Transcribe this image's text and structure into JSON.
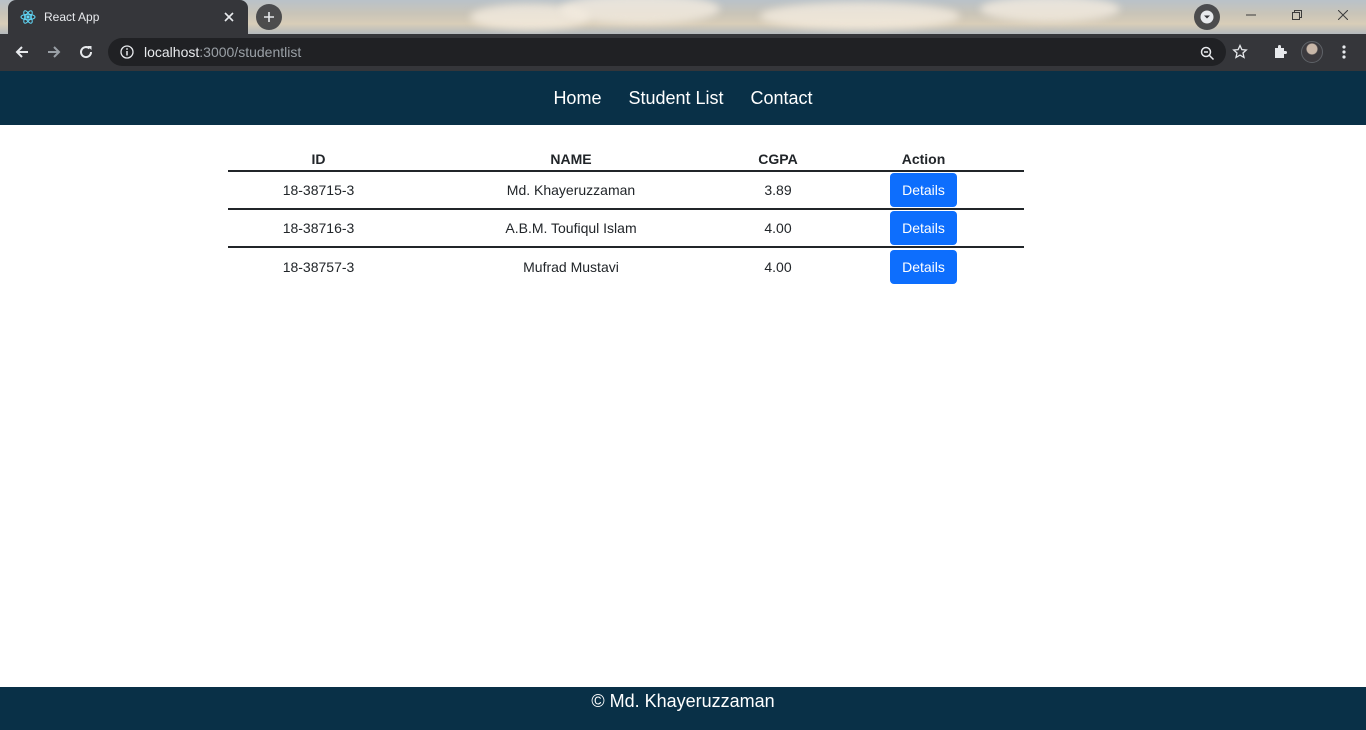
{
  "browser": {
    "tab_title": "React App",
    "url_host": "localhost",
    "url_path": ":3000/studentlist"
  },
  "nav": {
    "links": [
      "Home",
      "Student List",
      "Contact"
    ]
  },
  "table": {
    "headers": [
      "ID",
      "NAME",
      "CGPA",
      "Action"
    ],
    "rows": [
      {
        "id": "18-38715-3",
        "name": "Md. Khayeruzzaman",
        "cgpa": "3.89",
        "action": "Details"
      },
      {
        "id": "18-38716-3",
        "name": "A.B.M. Toufiqul Islam",
        "cgpa": "4.00",
        "action": "Details"
      },
      {
        "id": "18-38757-3",
        "name": "Mufrad Mustavi",
        "cgpa": "4.00",
        "action": "Details"
      }
    ]
  },
  "footer": {
    "text": "© Md. Khayeruzzaman"
  },
  "colors": {
    "navbar_bg": "#093047",
    "button_bg": "#0d6efd",
    "chrome_bg": "#35363a"
  }
}
